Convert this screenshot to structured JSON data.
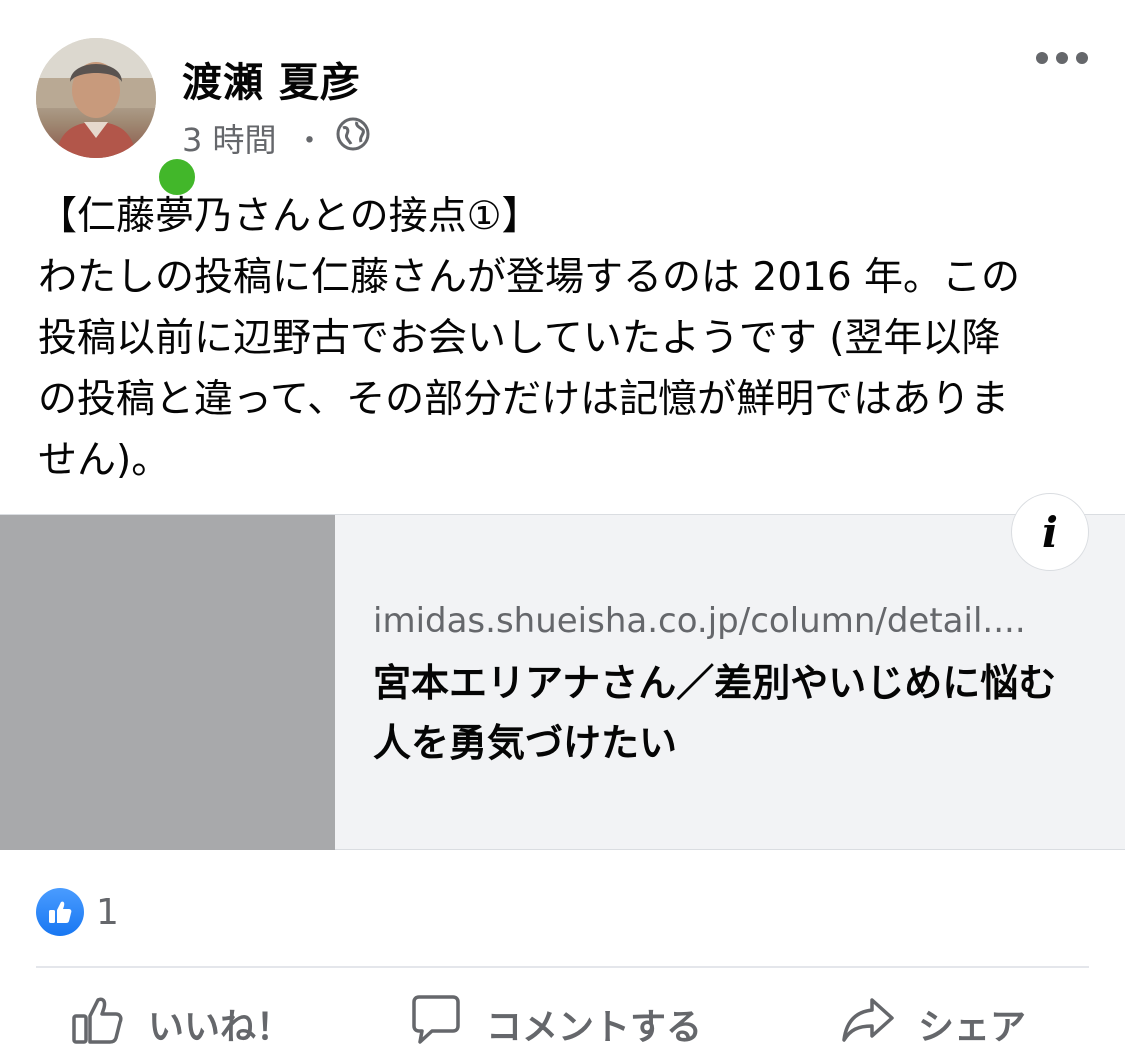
{
  "post": {
    "author": "渡瀬 夏彦",
    "time": "3 時間",
    "separator": "・",
    "text": "【仁藤夢乃さんとの接点①】\nわたしの投稿に仁藤さんが登場するのは 2016 年。この\n投稿以前に辺野古でお会いしていたようです (翌年以降\nの投稿と違って、その部分だけは記憶が鮮明ではありま\nせん)。"
  },
  "link_card": {
    "domain": "imidas.shueisha.co.jp/column/detail....",
    "title": "宮本エリアナさん／差別やいじめに悩む人を勇気づけたい",
    "info_label": "i"
  },
  "reactions": {
    "count": "1"
  },
  "actions": {
    "like": "いいね！",
    "comment": "コメントする",
    "share": "シェア"
  },
  "colors": {
    "online": "#42b72a",
    "like_blue": "#1877f2",
    "secondary_text": "#65676b"
  }
}
